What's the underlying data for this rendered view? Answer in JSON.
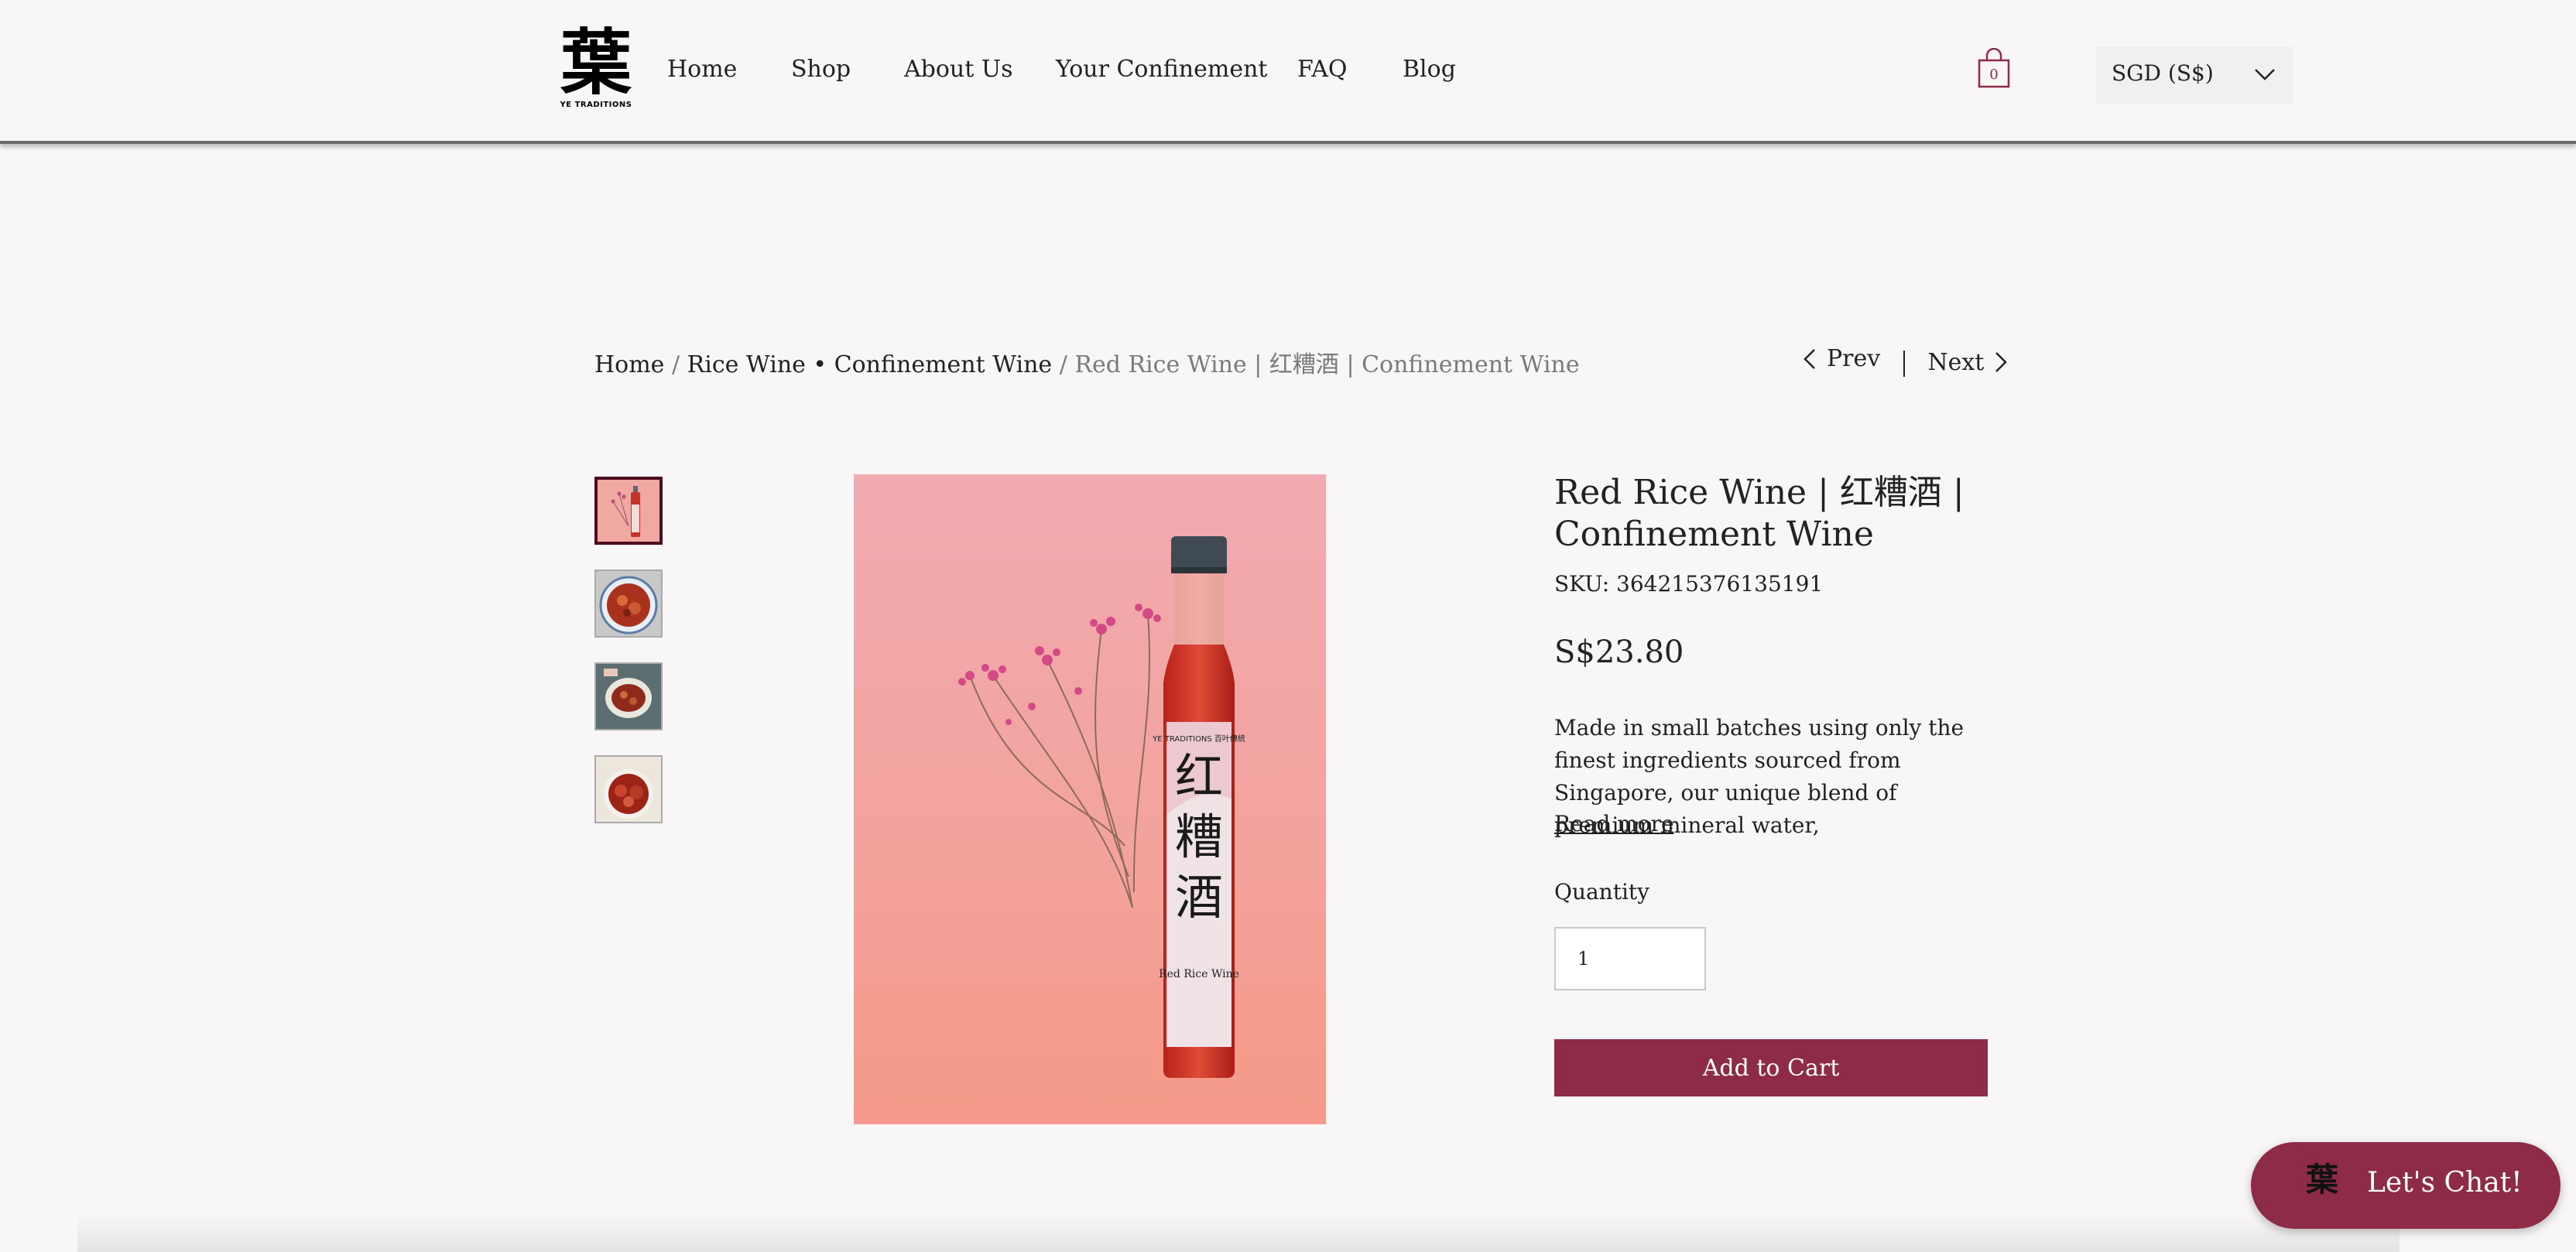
{
  "header": {
    "logo": {
      "glyph": "葉",
      "subtitle": "YE TRADITIONS"
    },
    "nav": [
      "Home",
      "Shop",
      "About Us",
      "Your Confinement",
      "FAQ",
      "Blog"
    ],
    "cart_count": "0",
    "currency": "SGD (S$)"
  },
  "breadcrumb": {
    "items": [
      "Home",
      "Rice Wine • Confinement Wine"
    ],
    "separator": "/",
    "current": "Red Rice Wine | 红糟酒 | Confinement Wine"
  },
  "pager": {
    "prev": "Prev",
    "next": "Next"
  },
  "gallery": {
    "thumbnails": [
      {
        "name": "bottle-thumbnail",
        "active": true
      },
      {
        "name": "dish-thumbnail-1",
        "active": false
      },
      {
        "name": "dish-thumbnail-2",
        "active": false
      },
      {
        "name": "dish-thumbnail-3",
        "active": false
      }
    ],
    "bottle_label": {
      "brand": "YE TRADITIONS",
      "brand_cn": "百叶傳統",
      "chars": [
        "红",
        "糟",
        "酒"
      ],
      "name": "Red Rice Wine"
    }
  },
  "product": {
    "title": "Red Rice Wine | 红糟酒 | Confinement Wine",
    "sku": "SKU: 364215376135191",
    "price": "S$23.80",
    "description": "Made in small batches using only the finest ingredients sourced from Singapore, our unique blend of premium mineral water,",
    "read_more": "Read more",
    "quantity_label": "Quantity",
    "quantity_value": "1",
    "add_to_cart": "Add to Cart"
  },
  "chat": {
    "label": "Let's Chat!",
    "logo_glyph": "葉"
  },
  "colors": {
    "accent": "#8e2c48",
    "background": "#f8f6f6"
  }
}
